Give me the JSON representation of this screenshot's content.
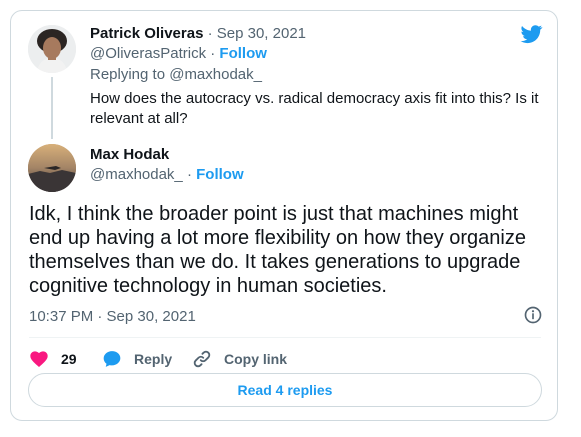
{
  "reply_tweet": {
    "author_name": "Patrick Oliveras",
    "date": "· Sep 30, 2021",
    "handle": "@OliverasPatrick ·",
    "follow_label": "Follow",
    "replying_to": "Replying to @maxhodak_",
    "text_lines": [
      "How does the autocracy vs. radical democracy axis fit into this? Is it",
      "relevant at all?"
    ]
  },
  "main_tweet": {
    "author_name": "Max Hodak",
    "handle": "@maxhodak_ ·",
    "follow_label": "Follow",
    "text_lines": [
      "Idk, I think the broader point is just that machines might",
      "end up having a lot more flexibility on how they organize",
      "themselves than we do. It takes generations to upgrade",
      "cognitive technology in human societies."
    ],
    "timestamp": "10:37 PM · Sep 30, 2021"
  },
  "actions": {
    "like_count": "29",
    "reply_label": "Reply",
    "copy_link_label": "Copy link"
  },
  "read_replies_label": "Read 4 replies",
  "icons": {
    "brand": "twitter-bird-icon",
    "info": "info-icon",
    "like": "heart-icon",
    "reply": "speech-bubble-icon",
    "copy": "link-icon"
  },
  "colors": {
    "accent": "#1d9bf0",
    "like": "#f91880",
    "text": "#0f1419",
    "muted": "#536471",
    "border": "#cfd9de"
  }
}
